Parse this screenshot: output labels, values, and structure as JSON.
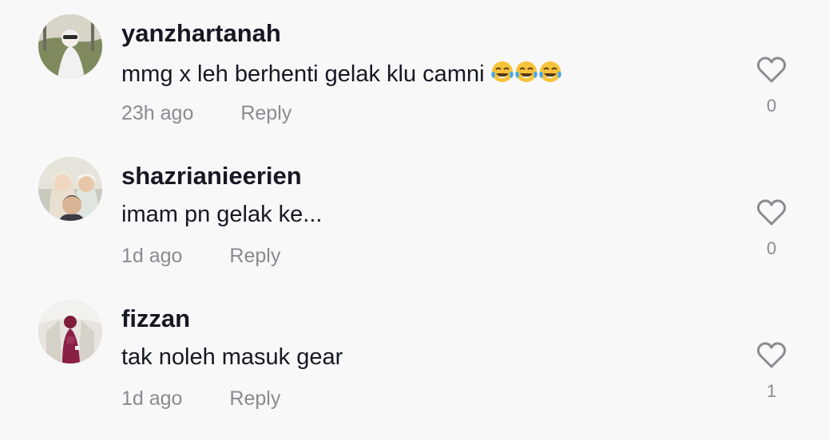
{
  "comments": [
    {
      "username": "yanzhartanah",
      "text": "mmg x leh berhenti gelak klu camni",
      "emoji": [
        "face-with-tears-of-joy",
        "face-with-tears-of-joy",
        "face-with-tears-of-joy"
      ],
      "time": "23h ago",
      "reply_label": "Reply",
      "like_count": "0"
    },
    {
      "username": "shazrianieerien",
      "text": "imam pn gelak ke...",
      "time": "1d ago",
      "reply_label": "Reply",
      "like_count": "0"
    },
    {
      "username": "fizzan",
      "text": "tak noleh masuk gear",
      "time": "1d ago",
      "reply_label": "Reply",
      "like_count": "1"
    }
  ],
  "colors": {
    "background": "#f8f8f8",
    "primary_text": "#161823",
    "secondary_text": "#8a8b91",
    "heart_outline": "#8a8b91"
  },
  "icons": {
    "like": "heart-outline-icon"
  }
}
